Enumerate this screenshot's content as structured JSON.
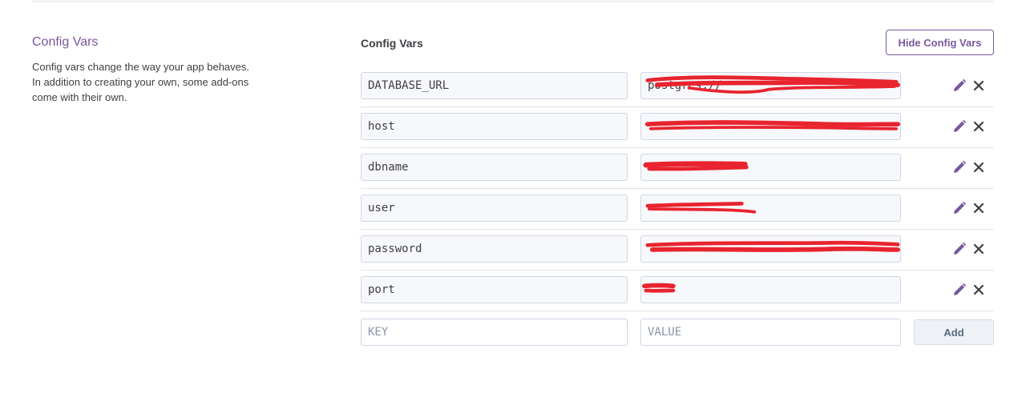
{
  "section": {
    "title": "Config Vars",
    "description": "Config vars change the way your app behaves. In addition to creating your own, some add-ons come with their own."
  },
  "panel": {
    "title": "Config Vars",
    "hide_button": "Hide Config Vars"
  },
  "vars": [
    {
      "key": "DATABASE_URL",
      "value": "postgres://",
      "redacted": true
    },
    {
      "key": "host",
      "value": "",
      "redacted": true
    },
    {
      "key": "dbname",
      "value": "",
      "redacted": true
    },
    {
      "key": "user",
      "value": "",
      "redacted": true
    },
    {
      "key": "password",
      "value": "",
      "redacted": true
    },
    {
      "key": "port",
      "value": "",
      "redacted": true
    }
  ],
  "new_var": {
    "key_placeholder": "KEY",
    "value_placeholder": "VALUE",
    "add_button": "Add"
  },
  "colors": {
    "accent": "#79589f",
    "redaction": "#e8242f",
    "icon": "#79589f",
    "delete_icon": "#3f3f44"
  },
  "icons": {
    "edit": "pencil-icon",
    "delete": "close-icon"
  }
}
